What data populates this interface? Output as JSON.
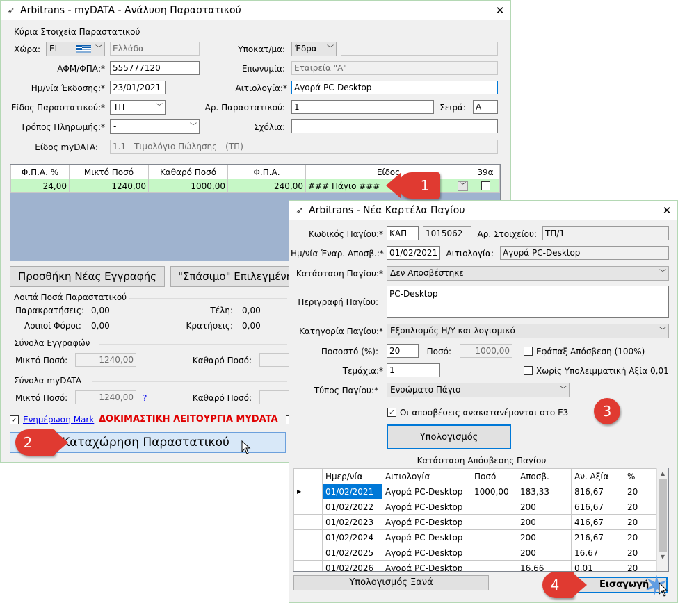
{
  "main_window": {
    "title": "Arbitrans - myDATA - Ανάλυση Παραστατικού",
    "section_main": "Κύρια Στοιχεία Παραστατικού",
    "country_label": "Χώρα:",
    "country_code": "EL",
    "country_name": "Ελλάδα",
    "branch_label": "Υποκατ/μα:",
    "branch_value": "Έδρα",
    "branch_extra": "",
    "vat_label": "ΑΦΜ/ΦΠΑ:*",
    "vat_value": "555777120",
    "name_label": "Επωνυμία:",
    "name_value": "Εταιρεία \"Α\"",
    "date_label": "Ημ/νία Έκδοσης:*",
    "date_value": "23/01/2021",
    "reason_label": "Αιτιολογία:*",
    "reason_value": "Αγορά PC-Desktop",
    "doctype_label": "Είδος Παραστατικού:*",
    "doctype_value": "ΤΠ",
    "docnum_label": "Αρ. Παραστατικού:",
    "docnum_value": "1",
    "series_label": "Σειρά:",
    "series_value": "Α",
    "payment_label": "Τρόπος Πληρωμής:*",
    "payment_value": "-",
    "notes_label": "Σχόλια:",
    "notes_value": "",
    "mydata_type_label": "Είδος myDATA:",
    "mydata_type_value": "1.1 - Τιμολόγιο Πώλησης - (ΤΠ)",
    "grid": {
      "headers": [
        "Φ.Π.Α. %",
        "Μικτό Ποσό",
        "Καθαρό Ποσό",
        "Φ.Π.Α.",
        "Είδος",
        "39α"
      ],
      "row": [
        "24,00",
        "1240,00",
        "1000,00",
        "240,00",
        "### Πάγιο ###"
      ]
    },
    "add_row_button": "Προσθήκη Νέας Εγγραφής",
    "split_button": "\"Σπάσιμο\" Επιλεγμένης",
    "section_other": "Λοιπά Ποσά Παραστατικού",
    "withholding_label": "Παρακρατήσεις:",
    "withholding_value": "0,00",
    "fees_label": "Τέλη:",
    "fees_value": "0,00",
    "othertax_label": "Λοιποί Φόροι:",
    "othertax_value": "0,00",
    "deductions_label": "Κρατήσεις:",
    "deductions_value": "0,00",
    "section_entries": "Σύνολα Εγγραφών",
    "gross_label": "Μικτό Ποσό:",
    "gross_value": "1240,00",
    "net_label": "Καθαρό Ποσό:",
    "section_mydata": "Σύνολα myDATA",
    "gross_value2": "1240,00",
    "help_link": "?",
    "update_mark_label": "Ενημέρωση Mark",
    "test_mode_text": "ΔΟΚΙΜΑΣΤΙΚΗ ΛΕΙΤΟΥΡΓΙΑ MYDATA",
    "submit_button": "Καταχώρηση Παραστατικού"
  },
  "asset_window": {
    "title": "Arbitrans - Νέα Καρτέλα Παγίου",
    "code_label": "Κωδικός Παγίου:*",
    "code_prefix": "ΚΑΠ",
    "code_number": "1015062",
    "docref_label": "Αρ. Στοιχείου:",
    "docref_value": "ΤΠ/1",
    "start_label": "Ημ/νία Έναρ. Αποσβ.:*",
    "start_value": "01/02/2021",
    "reason_label": "Αιτιολογία:",
    "reason_value": "Αγορά PC-Desktop",
    "status_label": "Κατάσταση Παγίου:*",
    "status_value": "Δεν Αποσβέστηκε",
    "desc_label": "Περιγραφή Παγίου:",
    "desc_value": "PC-Desktop",
    "category_label": "Κατηγορία Παγίου:*",
    "category_value": "Εξοπλισμός Η/Υ και λογισμικό",
    "percent_label": "Ποσοστό (%):",
    "percent_value": "20",
    "amount_label": "Ποσό:",
    "amount_value": "1000,00",
    "one_time_label": "Εφάπαξ Απόσβεση (100%)",
    "qty_label": "Τεμάχια:*",
    "qty_value": "1",
    "no_residual_label": "Χωρίς Υπολειμματική Αξία 0,01",
    "type_label": "Τύπος Παγίου:*",
    "type_value": "Ενσώματο Πάγιο",
    "redistribute_label": "Οι αποσβέσεις ανακατανέμονται στο Ε3",
    "calc_button": "Υπολογισμός",
    "schedule_title": "Κατάσταση Απόσβεσης Παγίου",
    "schedule_headers": [
      "Ημερ/νία",
      "Αιτιολογία",
      "Ποσό",
      "Αποσβ.",
      "Αν. Αξία",
      "%"
    ],
    "schedule_rows": [
      [
        "01/02/2021",
        "Αγορά PC-Desktop",
        "1000,00",
        "183,33",
        "816,67",
        "20"
      ],
      [
        "01/02/2022",
        "Αγορά PC-Desktop",
        "",
        "200",
        "616,67",
        "20"
      ],
      [
        "01/02/2023",
        "Αγορά PC-Desktop",
        "",
        "200",
        "416,67",
        "20"
      ],
      [
        "01/02/2024",
        "Αγορά PC-Desktop",
        "",
        "200",
        "216,67",
        "20"
      ],
      [
        "01/02/2025",
        "Αγορά PC-Desktop",
        "",
        "200",
        "16,67",
        "20"
      ],
      [
        "01/02/2026",
        "Αγορά PC-Desktop",
        "",
        "16,66",
        "0,01",
        "20"
      ]
    ],
    "recalc_button": "Υπολογισμός Ξανά",
    "insert_button": "Εισαγωγή"
  },
  "badges": [
    "1",
    "2",
    "3",
    "4"
  ],
  "colors": {
    "badge": "#e03a31",
    "grid_row": "#c6f7c6",
    "grid_empty": "#9fb3cf",
    "test_mode": "#e00000"
  }
}
